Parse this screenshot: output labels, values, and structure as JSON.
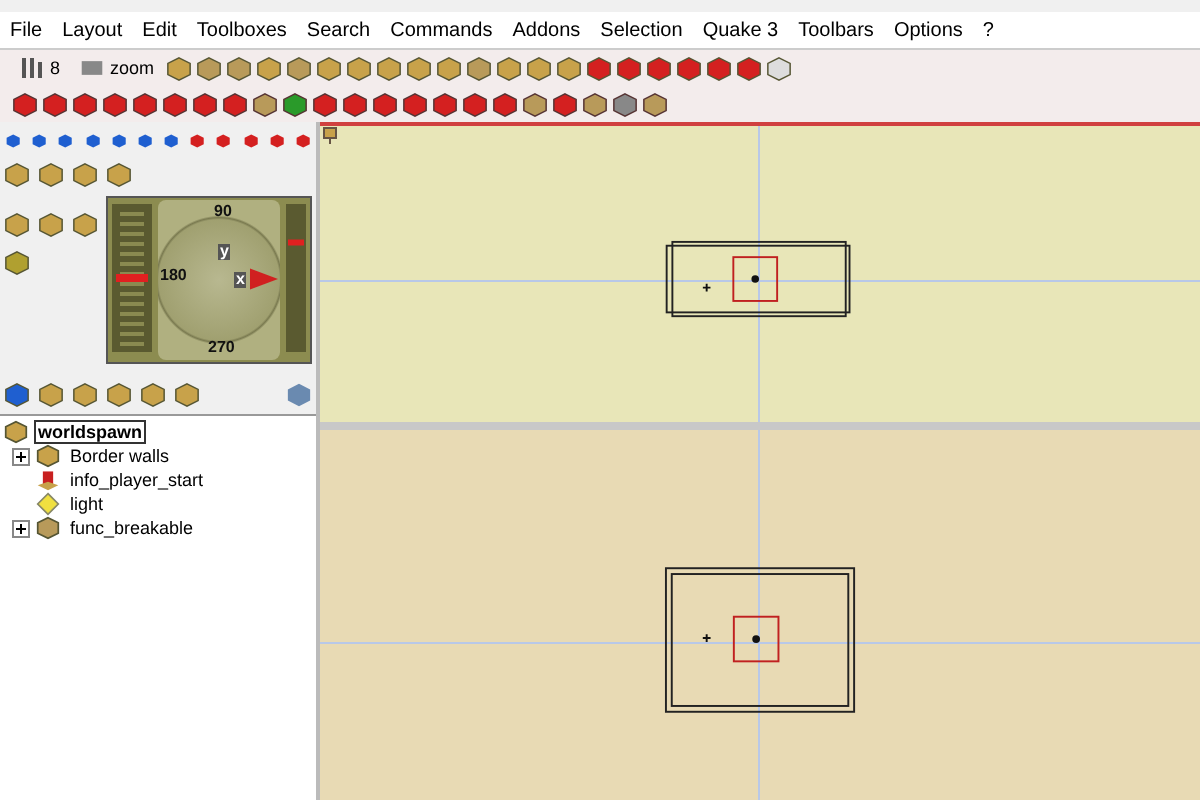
{
  "menu": [
    "File",
    "Layout",
    "Edit",
    "Toolboxes",
    "Search",
    "Commands",
    "Addons",
    "Selection",
    "Quake 3",
    "Toolbars",
    "Options",
    "?"
  ],
  "toolbar": {
    "grid_value": "8",
    "zoom_label": "zoom"
  },
  "compass": {
    "north": "90",
    "west": "180",
    "south": "270",
    "x_axis": "x",
    "y_axis": "y",
    "height": {
      "level": 0.5
    },
    "pitch": {
      "level": 0.75
    }
  },
  "tree": [
    {
      "label": "worldspawn",
      "kind": "group",
      "selected": true,
      "children": [
        {
          "label": "Border walls",
          "kind": "group",
          "selected": false,
          "expanded": false
        },
        {
          "label": "info_player_start",
          "kind": "player",
          "selected": false
        },
        {
          "label": "light",
          "kind": "light",
          "selected": false
        },
        {
          "label": "func_breakable",
          "kind": "brush",
          "selected": false,
          "expanded": false
        }
      ]
    }
  ]
}
